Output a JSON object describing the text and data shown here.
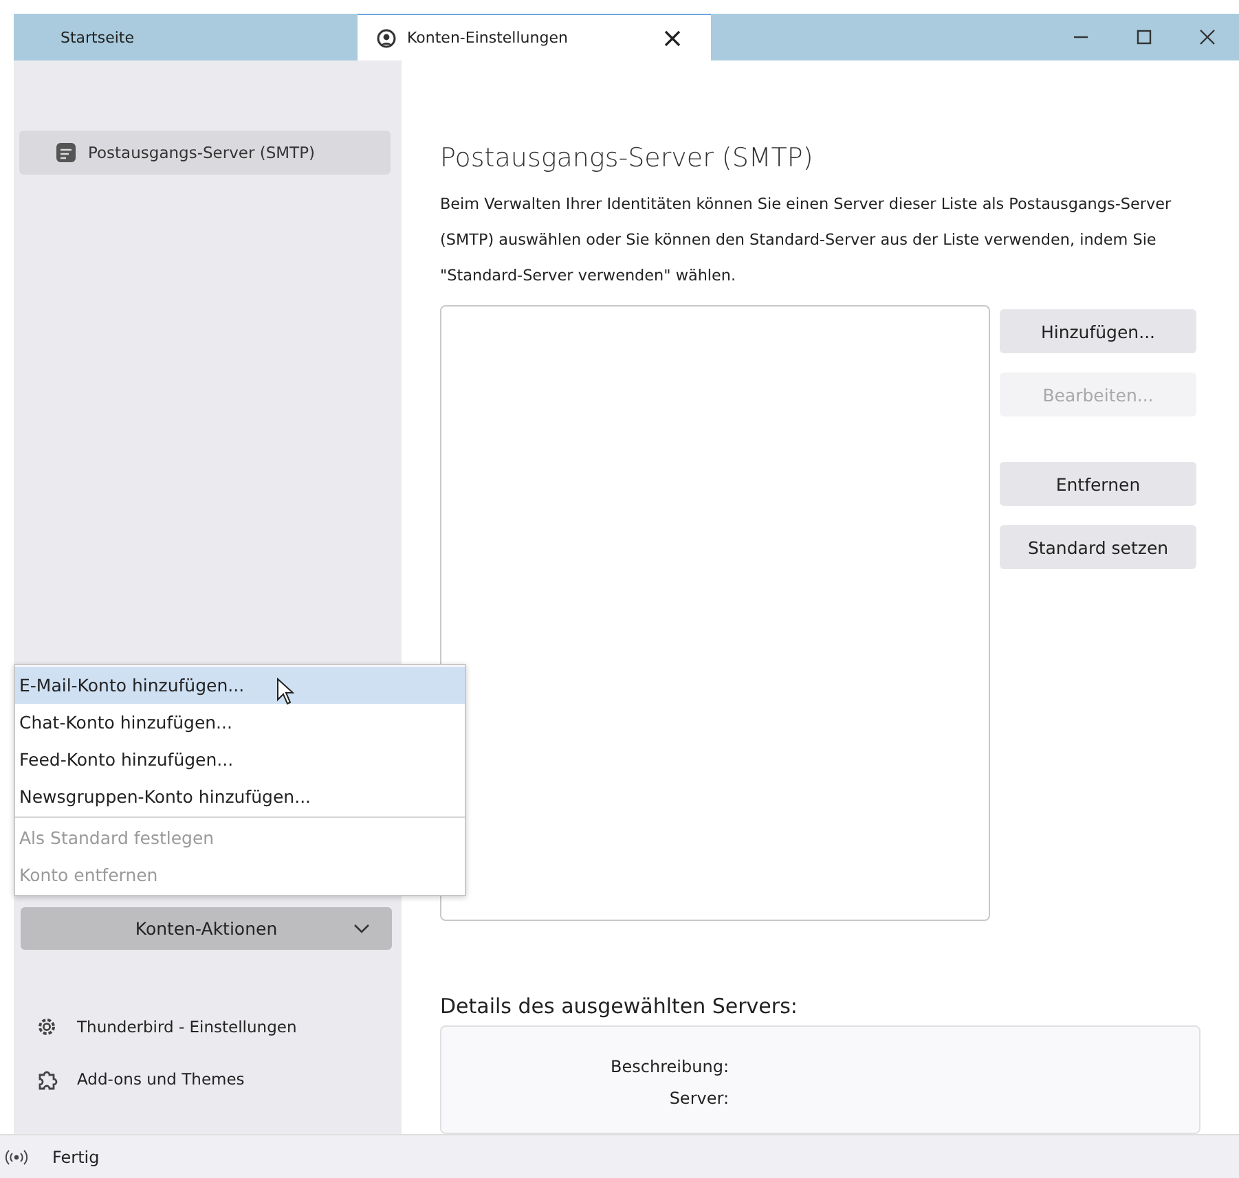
{
  "tabs": [
    {
      "label": "Startseite",
      "selected": false,
      "closable": false
    },
    {
      "label": "Konten-Einstellungen",
      "selected": true,
      "closable": true
    }
  ],
  "sidebar": {
    "items": [
      {
        "label": "Postausgangs-Server (SMTP)",
        "selected": true
      }
    ],
    "menu": [
      {
        "label": "E-Mail-Konto hinzufügen...",
        "highlighted": true,
        "disabled": false
      },
      {
        "label": "Chat-Konto hinzufügen...",
        "highlighted": false,
        "disabled": false
      },
      {
        "label": "Feed-Konto hinzufügen...",
        "highlighted": false,
        "disabled": false
      },
      {
        "label": "Newsgruppen-Konto hinzufügen...",
        "highlighted": false,
        "disabled": false
      },
      {
        "kind": "separator"
      },
      {
        "label": "Als Standard festlegen",
        "highlighted": false,
        "disabled": true
      },
      {
        "label": "Konto entfernen",
        "highlighted": false,
        "disabled": true
      }
    ],
    "actions_button": {
      "label": "Konten-Aktionen",
      "expanded": true
    },
    "footer": [
      {
        "label": "Thunderbird - Einstellungen"
      },
      {
        "label": "Add-ons und Themes"
      }
    ]
  },
  "main": {
    "title": "Postausgangs-Server (SMTP)",
    "description": "Beim Verwalten Ihrer Identitäten können Sie einen Server dieser Liste als Postausgangs-Server (SMTP) auswählen oder Sie können den Standard-Server aus der Liste verwenden, indem Sie \"Standard-Server verwenden\" wählen.",
    "buttons": [
      {
        "label": "Hinzufügen...",
        "disabled": false
      },
      {
        "label": "Bearbeiten...",
        "disabled": true
      },
      {
        "label": "Entfernen",
        "disabled": false
      },
      {
        "label": "Standard setzen",
        "disabled": false
      }
    ],
    "details": {
      "heading": "Details des ausgewählten Servers:",
      "fields": [
        "Beschreibung:",
        "Server:"
      ]
    }
  },
  "status_bar": {
    "text": "Fertig"
  }
}
